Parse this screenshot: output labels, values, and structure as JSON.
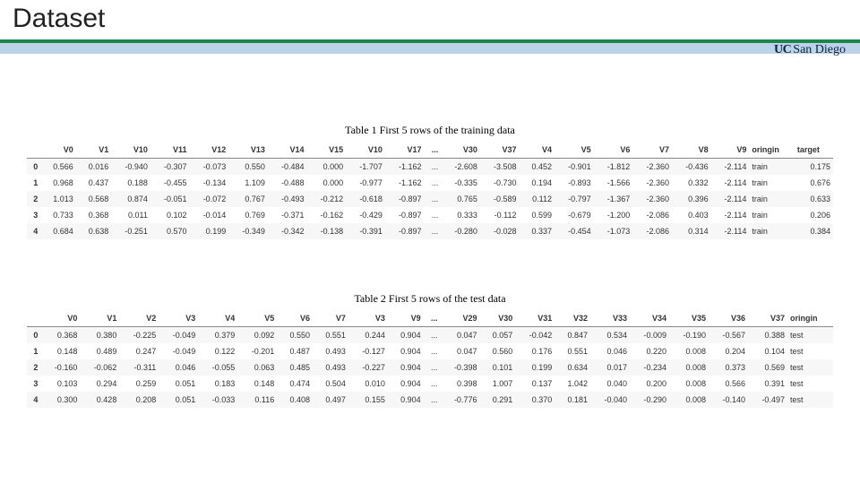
{
  "title": "Dataset",
  "logo": {
    "uc": "UC",
    "sd": "San Diego"
  },
  "table1": {
    "caption": "Table 1 First 5 rows of the training data",
    "headers": [
      "",
      "V0",
      "V1",
      "V10",
      "V11",
      "V12",
      "V13",
      "V14",
      "V15",
      "V10",
      "V17",
      "...",
      "V30",
      "V37",
      "V4",
      "V5",
      "V6",
      "V7",
      "V8",
      "V9",
      "oringin",
      "target"
    ],
    "rows": [
      [
        "0",
        "0.566",
        "0.016",
        "-0.940",
        "-0.307",
        "-0.073",
        "0.550",
        "-0.484",
        "0.000",
        "-1.707",
        "-1.162",
        "...",
        "-2.608",
        "-3.508",
        "0.452",
        "-0.901",
        "-1.812",
        "-2.360",
        "-0.436",
        "-2.114",
        "train",
        "0.175"
      ],
      [
        "1",
        "0.968",
        "0.437",
        "0.188",
        "-0.455",
        "-0.134",
        "1.109",
        "-0.488",
        "0.000",
        "-0.977",
        "-1.162",
        "...",
        "-0.335",
        "-0.730",
        "0.194",
        "-0.893",
        "-1.566",
        "-2.360",
        "0.332",
        "-2.114",
        "train",
        "0.676"
      ],
      [
        "2",
        "1.013",
        "0.568",
        "0.874",
        "-0.051",
        "-0.072",
        "0.767",
        "-0.493",
        "-0.212",
        "-0.618",
        "-0.897",
        "...",
        "0.765",
        "-0.589",
        "0.112",
        "-0.797",
        "-1.367",
        "-2.360",
        "0.396",
        "-2.114",
        "train",
        "0.633"
      ],
      [
        "3",
        "0.733",
        "0.368",
        "0.011",
        "0.102",
        "-0.014",
        "0.769",
        "-0.371",
        "-0.162",
        "-0.429",
        "-0.897",
        "...",
        "0.333",
        "-0.112",
        "0.599",
        "-0.679",
        "-1.200",
        "-2.086",
        "0.403",
        "-2.114",
        "train",
        "0.206"
      ],
      [
        "4",
        "0.684",
        "0.638",
        "-0.251",
        "0.570",
        "0.199",
        "-0.349",
        "-0.342",
        "-0.138",
        "-0.391",
        "-0.897",
        "...",
        "-0.280",
        "-0.028",
        "0.337",
        "-0.454",
        "-1.073",
        "-2.086",
        "0.314",
        "-2.114",
        "train",
        "0.384"
      ]
    ]
  },
  "table2": {
    "caption": "Table 2 First 5 rows of the test data",
    "headers": [
      "",
      "V0",
      "V1",
      "V2",
      "V3",
      "V4",
      "V5",
      "V6",
      "V7",
      "V3",
      "V9",
      "...",
      "V29",
      "V30",
      "V31",
      "V32",
      "V33",
      "V34",
      "V35",
      "V36",
      "V37",
      "oringin"
    ],
    "rows": [
      [
        "0",
        "0.368",
        "0.380",
        "-0.225",
        "-0.049",
        "0.379",
        "0.092",
        "0.550",
        "0.551",
        "0.244",
        "0.904",
        "...",
        "0.047",
        "0.057",
        "-0.042",
        "0.847",
        "0.534",
        "-0.009",
        "-0.190",
        "-0.567",
        "0.388",
        "test"
      ],
      [
        "1",
        "0.148",
        "0.489",
        "0.247",
        "-0.049",
        "0.122",
        "-0.201",
        "0.487",
        "0.493",
        "-0.127",
        "0.904",
        "...",
        "0.047",
        "0.560",
        "0.176",
        "0.551",
        "0.046",
        "0.220",
        "0.008",
        "0.204",
        "0.104",
        "test"
      ],
      [
        "2",
        "-0.160",
        "-0.062",
        "-0.311",
        "0.046",
        "-0.055",
        "0.063",
        "0.485",
        "0.493",
        "-0.227",
        "0.904",
        "...",
        "-0.398",
        "0.101",
        "0.199",
        "0.634",
        "0.017",
        "-0.234",
        "0.008",
        "0.373",
        "0.569",
        "test"
      ],
      [
        "3",
        "0.103",
        "0.294",
        "0.259",
        "0.051",
        "0.183",
        "0.148",
        "0.474",
        "0.504",
        "0.010",
        "0.904",
        "...",
        "0.398",
        "1.007",
        "0.137",
        "1.042",
        "0.040",
        "0.200",
        "0.008",
        "0.566",
        "0.391",
        "test"
      ],
      [
        "4",
        "0.300",
        "0.428",
        "0.208",
        "0.051",
        "-0.033",
        "0.116",
        "0.408",
        "0.497",
        "0.155",
        "0.904",
        "...",
        "-0.776",
        "0.291",
        "0.370",
        "0.181",
        "-0.040",
        "-0.290",
        "0.008",
        "-0.140",
        "-0.497",
        "test"
      ]
    ]
  }
}
